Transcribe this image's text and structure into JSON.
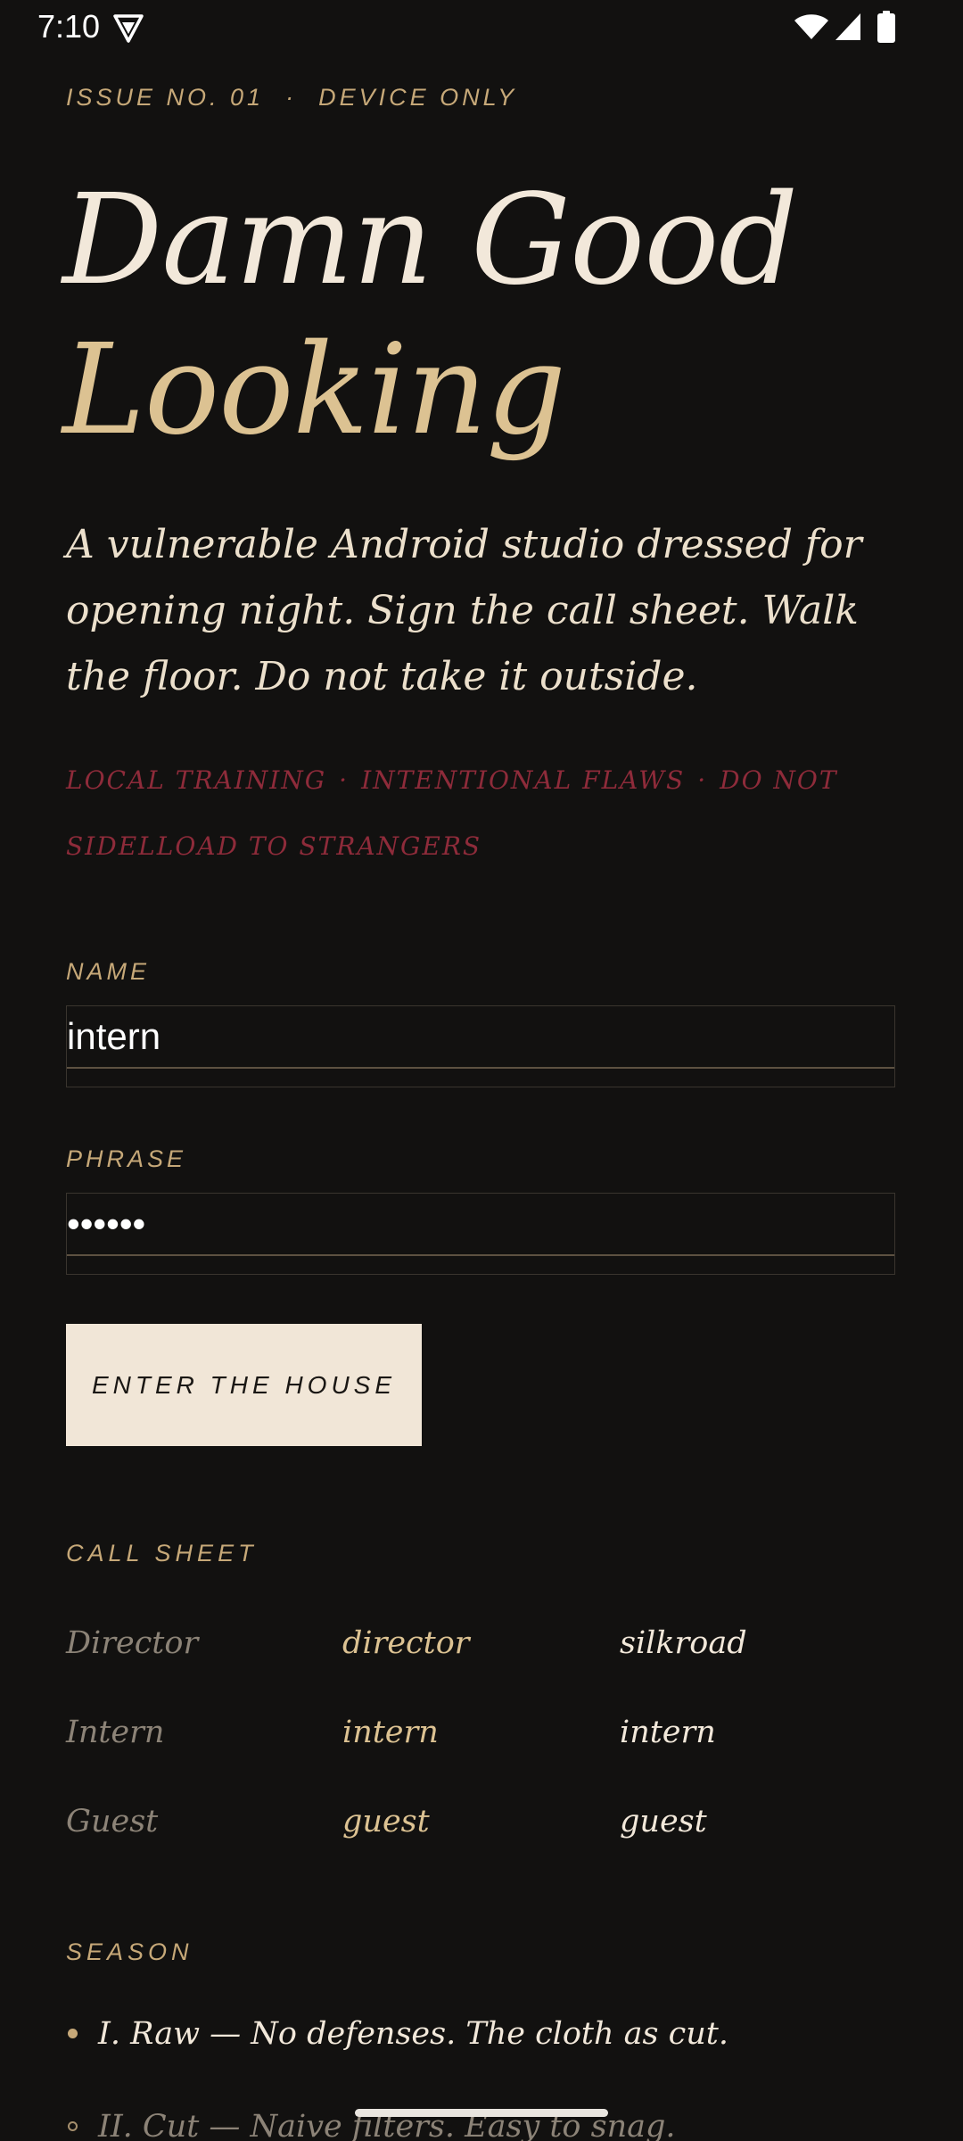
{
  "status_bar": {
    "time": "7:10",
    "icons": [
      "vpn-icon",
      "wifi-icon",
      "signal-icon",
      "battery-icon"
    ]
  },
  "eyebrow": {
    "issue": "ISSUE NO. 01",
    "separator": "·",
    "tag": "DEVICE ONLY"
  },
  "title": {
    "line1": "Damn Good",
    "line2": "Looking"
  },
  "lede": "A vulnerable Android studio dressed for opening night. Sign the call sheet. Walk the floor. Do not take it outside.",
  "warning": {
    "parts": [
      "LOCAL TRAINING",
      "INTENTIONAL FLAWS",
      "DO NOT SIDELLOAD TO STRANGERS"
    ],
    "separator": "·"
  },
  "form": {
    "name_label": "NAME",
    "name_value": "intern",
    "phrase_label": "PHRASE",
    "phrase_value": "secret",
    "submit_label": "ENTER THE HOUSE"
  },
  "call_sheet": {
    "label": "CALL SHEET",
    "rows": [
      {
        "role": "Director",
        "username": "director",
        "password": "silkroad"
      },
      {
        "role": "Intern",
        "username": "intern",
        "password": "intern"
      },
      {
        "role": "Guest",
        "username": "guest",
        "password": "guest"
      }
    ]
  },
  "season": {
    "label": "SEASON",
    "items": [
      "I. Raw — No defenses. The cloth as cut.",
      "II. Cut — Naive filters. Easy to snag."
    ]
  },
  "colors": {
    "background": "#121110",
    "accent_gold": "#c6a878",
    "title_gold": "#dcc292",
    "cream": "#f1e6d7",
    "warning_red": "#8e2b3a"
  }
}
